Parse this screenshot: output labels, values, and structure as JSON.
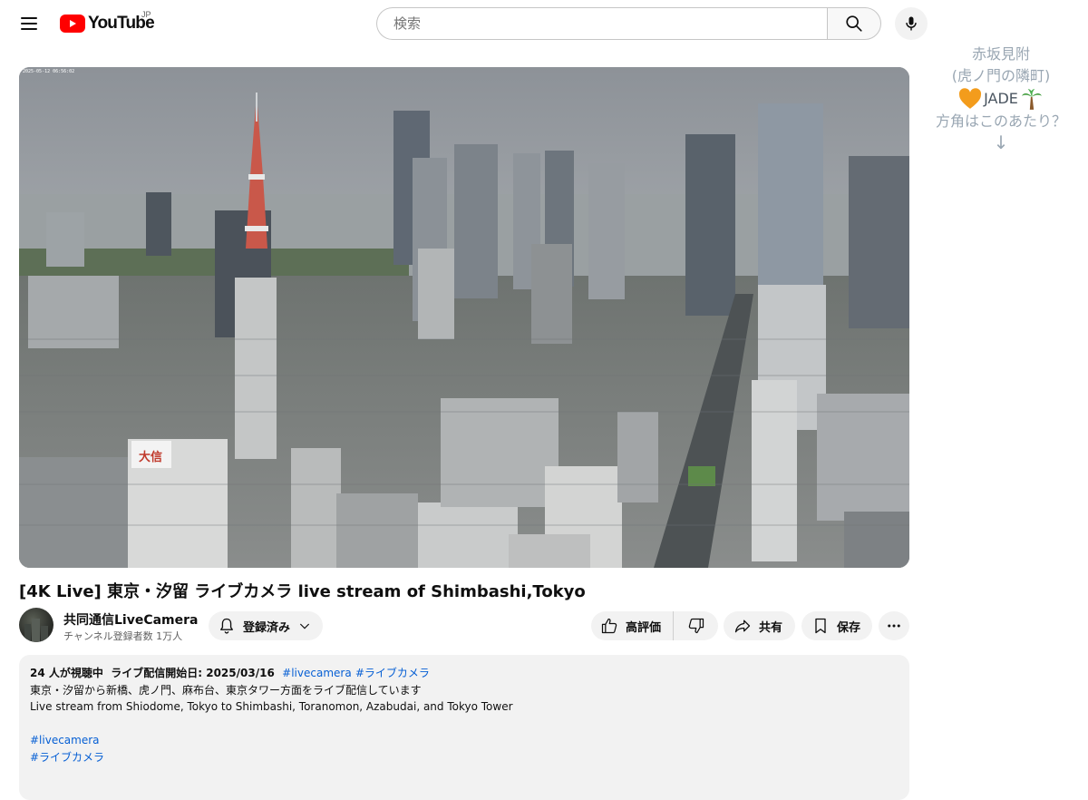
{
  "masthead": {
    "logo_text": "YouTube",
    "region": "JP",
    "search_placeholder": "検索"
  },
  "player": {
    "overlay_timestamp": "2025-05-12 06:56:02"
  },
  "annotation": {
    "line1": "赤坂見附",
    "line2": "(虎ノ門の隣町)",
    "brand": "JADE",
    "line4": "方角はこのあたり？",
    "arrow": "↓"
  },
  "video": {
    "title": "[4K Live] 東京・汐留 ライブカメラ live stream of Shimbashi,Tokyo"
  },
  "channel": {
    "name": "共同通信LiveCamera",
    "subscribers": "チャンネル登録者数 1万人",
    "subscribed_label": "登録済み"
  },
  "actions": {
    "like_label": "高評価",
    "share_label": "共有",
    "save_label": "保存"
  },
  "description": {
    "viewers": "24 人が視聴中",
    "started": "ライブ配信開始日: 2025/03/16",
    "tag_inline_1": "#livecamera",
    "tag_inline_2": "#ライブカメラ",
    "line_ja": "東京・汐留から新橋、虎ノ門、麻布台、東京タワー方面をライブ配信しています",
    "line_en": "Live stream from Shiodome, Tokyo to Shimbashi, Toranomon, Azabudai, and Tokyo Tower",
    "tag1": "#livecamera",
    "tag2": "#ライブカメラ"
  },
  "colors": {
    "brand_red": "#ff0000",
    "link_blue": "#065fd4",
    "annotation_gray": "#9aa7b3"
  },
  "icons": [
    "menu-icon",
    "youtube-play-icon",
    "search-icon",
    "mic-icon",
    "bell-icon",
    "chevron-down-icon",
    "thumb-up-icon",
    "thumb-down-icon",
    "share-icon",
    "bookmark-icon",
    "more-horiz-icon",
    "heart-icon",
    "palm-tree-icon"
  ]
}
